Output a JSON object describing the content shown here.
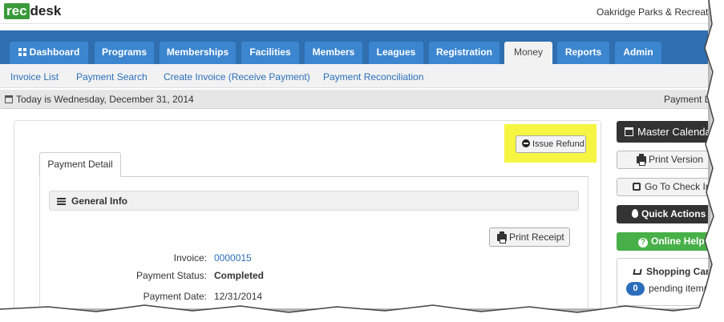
{
  "app": {
    "logo_rec": "rec",
    "logo_desk": "desk",
    "org_name": "Oakridge Parks & Recreati"
  },
  "main_nav": {
    "tabs": [
      {
        "label": "Dashboard",
        "icon": "grid-icon"
      },
      {
        "label": "Programs"
      },
      {
        "label": "Memberships"
      },
      {
        "label": "Facilities"
      },
      {
        "label": "Members"
      },
      {
        "label": "Leagues"
      },
      {
        "label": "Registration"
      },
      {
        "label": "Money",
        "active": true
      },
      {
        "label": "Reports"
      },
      {
        "label": "Admin"
      }
    ]
  },
  "sub_nav": {
    "links": [
      "Invoice List",
      "Payment Search",
      "Create Invoice (Receive Payment)",
      "Payment Reconciliation"
    ]
  },
  "date_bar": {
    "date_text": "Today is Wednesday, December 31, 2014",
    "right_link": "Payment L"
  },
  "panel": {
    "issue_refund_label": "Issue Refund",
    "tab_label": "Payment Detail",
    "section_title": "General Info",
    "print_receipt_label": "Print Receipt",
    "fields": [
      {
        "label": "Invoice:",
        "value": "0000015",
        "is_link": true
      },
      {
        "label": "Payment Status:",
        "value": "Completed",
        "bold": true
      },
      {
        "label": "Payment Date:",
        "value": "12/31/2014"
      }
    ]
  },
  "sidebar": {
    "master_calendar": "Master Calenda",
    "print_version": "Print Version",
    "go_to_check_in": "Go To Check In",
    "quick_actions": "Quick Actions",
    "online_help": "Online Help",
    "shopping_cart_title": "Shopping Cart",
    "pending_count": "0",
    "pending_text": "pending item(s"
  },
  "colors": {
    "nav_bar": "#2f6fb0",
    "nav_tab": "#3c86d0",
    "link": "#2a6ebb",
    "highlight": "#f5f542",
    "help_green": "#48b048",
    "logo_green": "#3a9a3a"
  }
}
